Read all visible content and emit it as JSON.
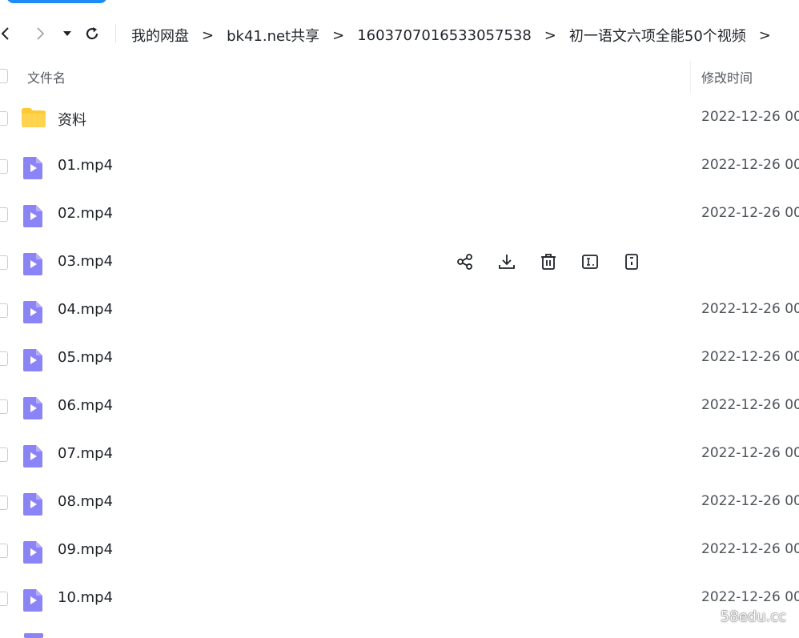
{
  "breadcrumb": [
    "我的网盘",
    "bk41.net共享",
    "1603707016533057538",
    "初一语文六项全能50个视频"
  ],
  "breadcrumb_separator": ">",
  "columns": {
    "name": "文件名",
    "modified": "修改时间"
  },
  "files": [
    {
      "type": "folder",
      "name": "资料",
      "modified": "2022-12-26 00"
    },
    {
      "type": "video",
      "name": "01.mp4",
      "modified": "2022-12-26 00"
    },
    {
      "type": "video",
      "name": "02.mp4",
      "modified": "2022-12-26 00"
    },
    {
      "type": "video",
      "name": "03.mp4",
      "modified": ""
    },
    {
      "type": "video",
      "name": "04.mp4",
      "modified": "2022-12-26 00"
    },
    {
      "type": "video",
      "name": "05.mp4",
      "modified": "2022-12-26 00"
    },
    {
      "type": "video",
      "name": "06.mp4",
      "modified": "2022-12-26 00"
    },
    {
      "type": "video",
      "name": "07.mp4",
      "modified": "2022-12-26 00"
    },
    {
      "type": "video",
      "name": "08.mp4",
      "modified": "2022-12-26 00"
    },
    {
      "type": "video",
      "name": "09.mp4",
      "modified": "2022-12-26 00"
    },
    {
      "type": "video",
      "name": "10.mp4",
      "modified": "2022-12-26 00"
    }
  ],
  "hover_actions": [
    "share-icon",
    "download-icon",
    "delete-icon",
    "rename-icon",
    "info-icon"
  ],
  "watermark": "58edu.cc",
  "colors": {
    "accent": "#1d8cf8",
    "folder": "#ffc933",
    "video": "#8b84f5"
  }
}
